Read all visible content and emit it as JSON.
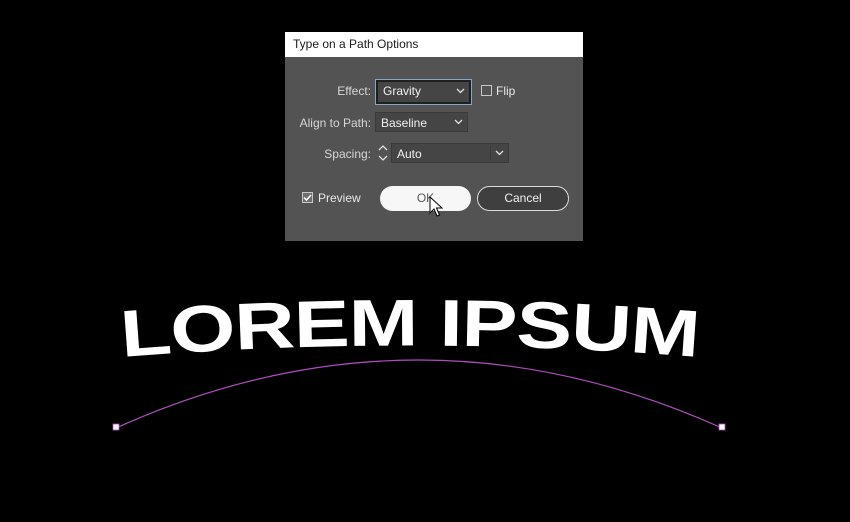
{
  "dialog": {
    "title": "Type on a Path Options",
    "effect": {
      "label": "Effect:",
      "value": "Gravity"
    },
    "flip": {
      "label": "Flip",
      "checked": false
    },
    "align": {
      "label": "Align to Path:",
      "value": "Baseline"
    },
    "spacing": {
      "label": "Spacing:",
      "value": "Auto"
    },
    "preview": {
      "label": "Preview",
      "checked": true
    },
    "ok_label": "OK",
    "cancel_label": "Cancel"
  },
  "artwork": {
    "path_text": "LOREM IPSUM",
    "path_color": "#b04cc0",
    "text_color": "#ffffff"
  },
  "icons": {
    "cursor": "arrow-pointer-icon",
    "dropdown": "chevron-down-icon",
    "stepper": "stepper-arrows-icon",
    "check": "checkmark-icon"
  }
}
